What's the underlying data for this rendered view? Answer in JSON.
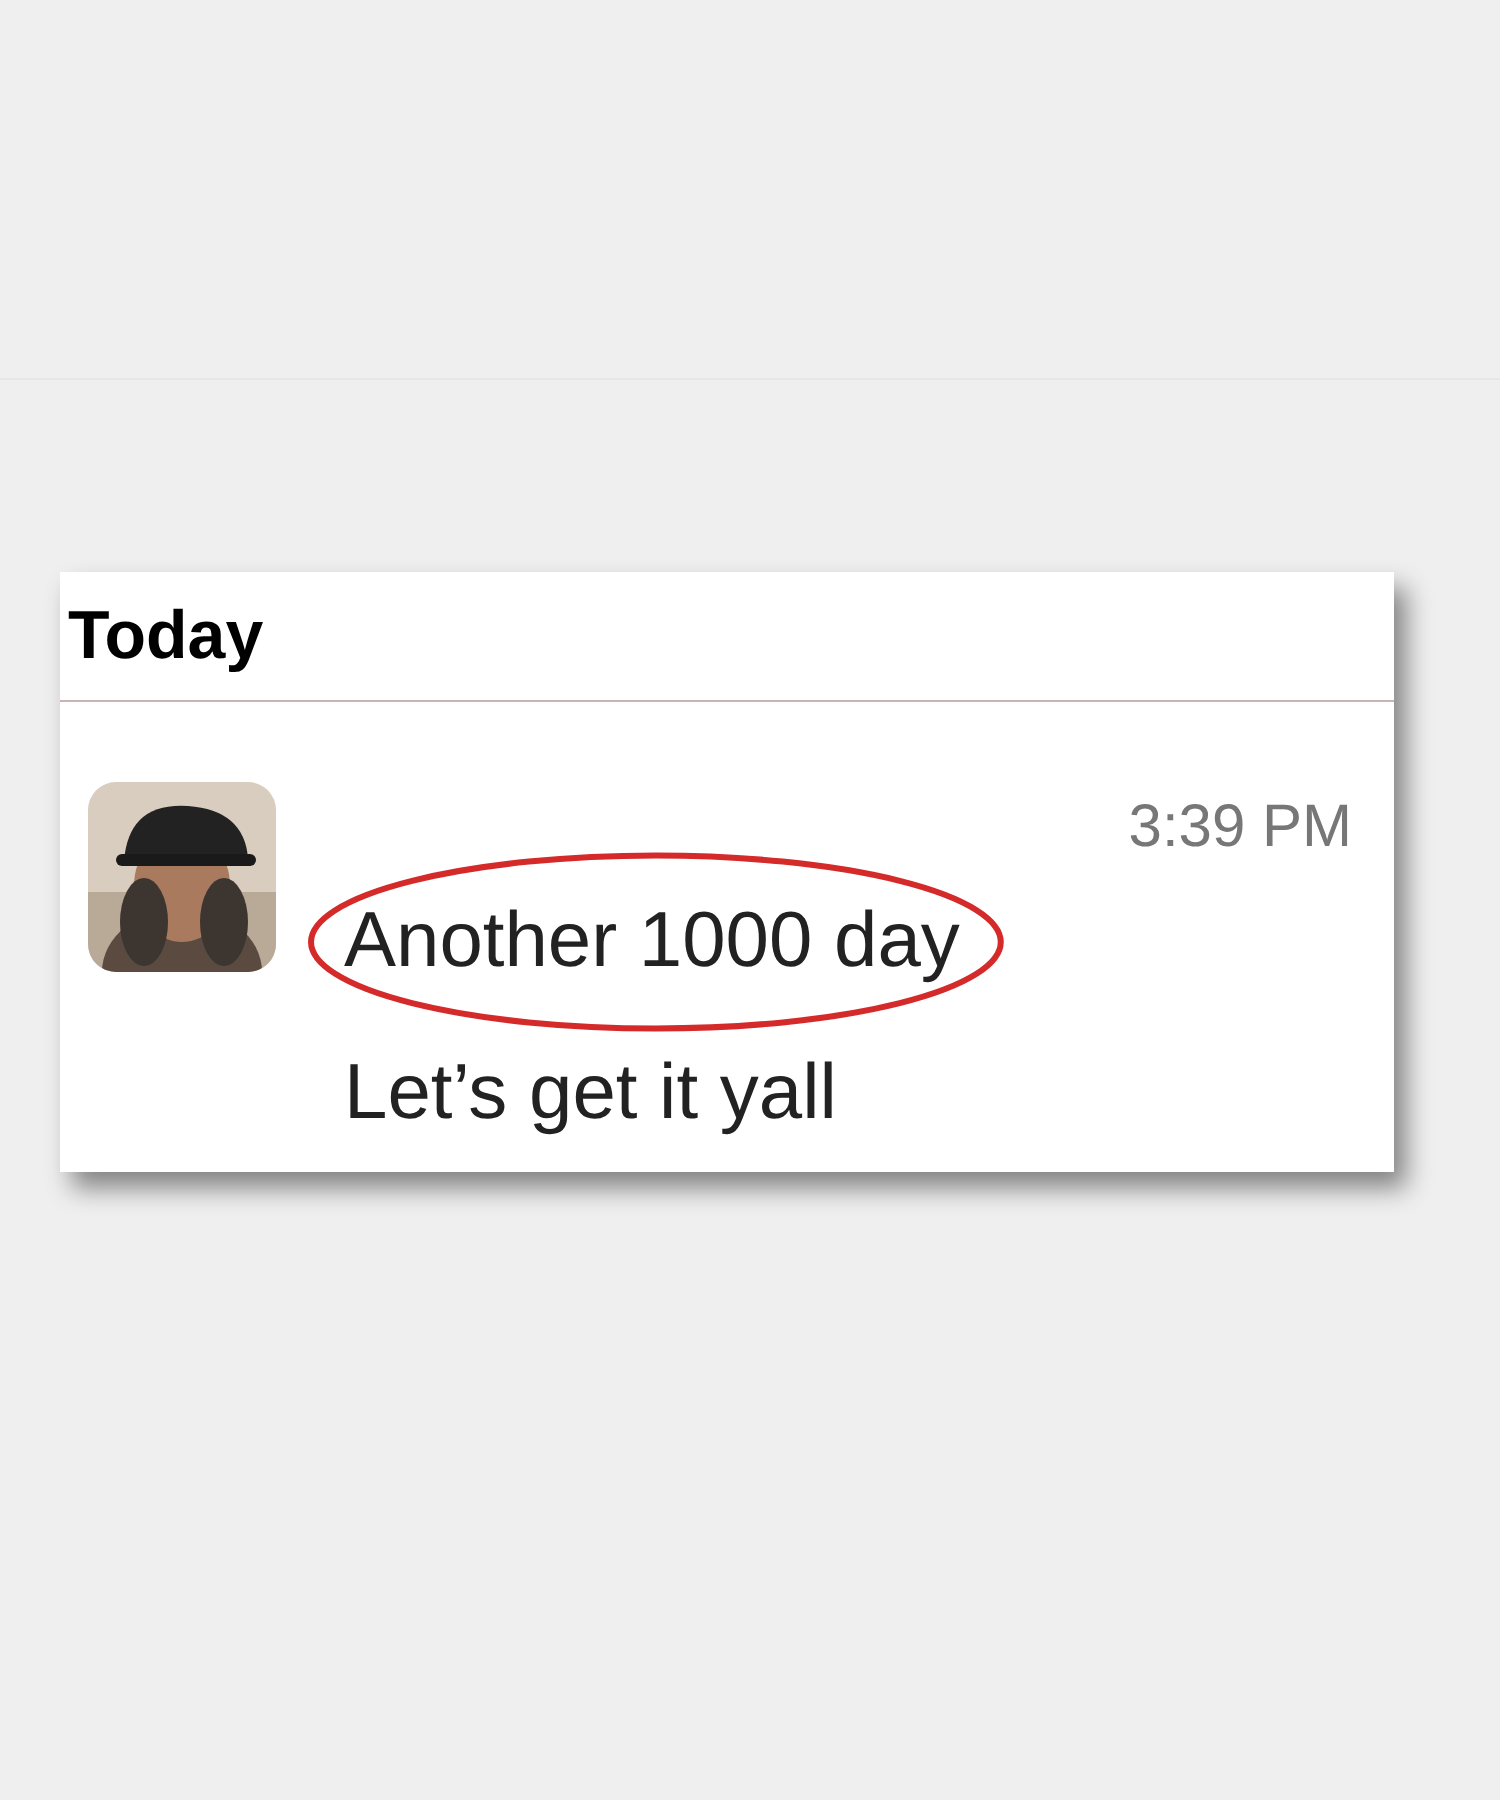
{
  "date_header": "Today",
  "message": {
    "time": "3:39 PM",
    "lines": [
      {
        "text": "Another 1000 day",
        "circled": true
      },
      {
        "text": "Let’s get it yall",
        "circled": false
      }
    ]
  }
}
